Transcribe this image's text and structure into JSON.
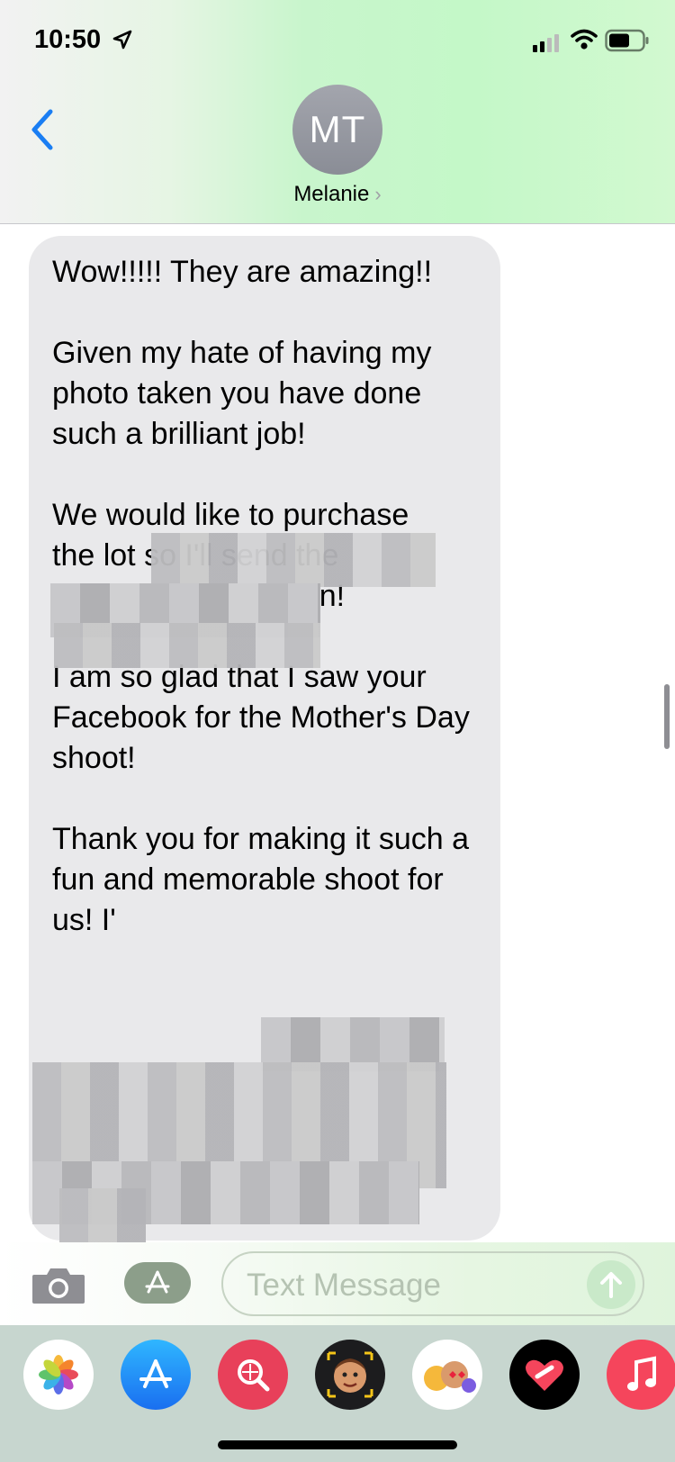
{
  "status_bar": {
    "time": "10:50"
  },
  "header": {
    "avatar_initials": "MT",
    "contact_name": "Melanie"
  },
  "message": {
    "paragraphs": [
      "Wow!!!!! They are amazing!!",
      "Given my hate of having my photo taken you have done such a brilliant job!",
      "We would like to purchase the lot so I'll send the payment across then!",
      "I am so glad that I saw your Facebook for the Mother's Day shoot!",
      "Thank you for making it such a fun and memorable shoot for us! I'"
    ]
  },
  "composer": {
    "placeholder": "Text Message"
  },
  "app_drawer": {
    "icons": [
      "photos-icon",
      "app-store-icon",
      "images-search-icon",
      "memoji-stickers-icon",
      "animoji-icon",
      "digital-touch-icon",
      "music-icon"
    ]
  },
  "colors": {
    "accent": "#1a7ef3",
    "bubble": "#e9e9eb",
    "music": "#f5455c",
    "search": "#e8405a"
  }
}
